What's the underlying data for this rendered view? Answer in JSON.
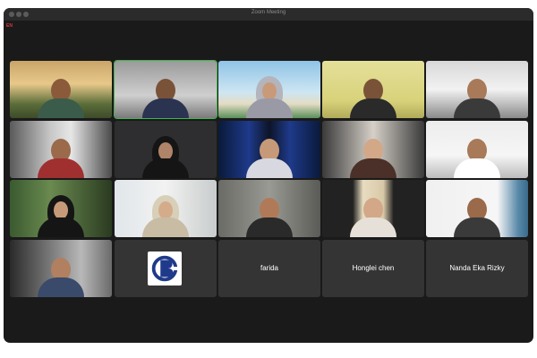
{
  "window": {
    "title": "Zoom Meeting",
    "recording_badge": "EN"
  },
  "colors": {
    "active_speaker_border": "#3fb54a",
    "empty_tile": "#343434",
    "window_bg": "#1a1a1a"
  },
  "participants": [
    {
      "label": "",
      "video": "on",
      "active": false
    },
    {
      "label": "",
      "video": "on",
      "active": true
    },
    {
      "label": "",
      "video": "on",
      "active": false
    },
    {
      "label": "",
      "video": "on",
      "active": false
    },
    {
      "label": "",
      "video": "on",
      "active": false
    },
    {
      "label": "",
      "video": "on",
      "active": false
    },
    {
      "label": "",
      "video": "on",
      "active": false
    },
    {
      "label": "",
      "video": "on",
      "active": false
    },
    {
      "label": "",
      "video": "on",
      "active": false
    },
    {
      "label": "",
      "video": "on",
      "active": false
    },
    {
      "label": "",
      "video": "on",
      "active": false
    },
    {
      "label": "",
      "video": "on",
      "active": false
    },
    {
      "label": "",
      "video": "on",
      "active": false
    },
    {
      "label": "",
      "video": "on",
      "active": false
    },
    {
      "label": "",
      "video": "on",
      "active": false
    },
    {
      "label": "",
      "video": "on",
      "active": false
    },
    {
      "label": "",
      "video": "off",
      "avatar": "logo-icon",
      "active": false
    },
    {
      "label": "farida",
      "video": "off",
      "active": false
    },
    {
      "label": "Honglei chen",
      "video": "off",
      "active": false
    },
    {
      "label": "Nanda Eka Rizky",
      "video": "off",
      "active": false
    }
  ]
}
